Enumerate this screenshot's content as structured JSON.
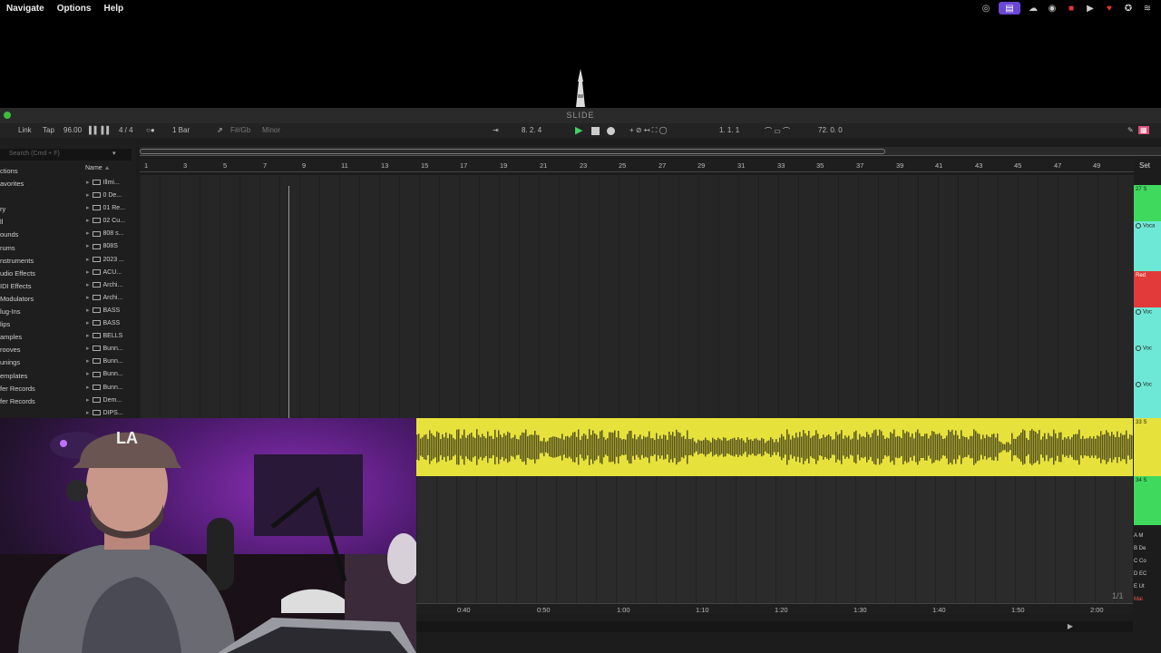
{
  "menu": [
    "Navigate",
    "Options",
    "Help"
  ],
  "status_icons": [
    "creative-cloud-icon",
    "screen-share-icon",
    "cloud-sync-icon",
    "recorder-icon",
    "play-circle-icon",
    "shield-icon",
    "compass-icon",
    "wifi-icon"
  ],
  "window": {
    "title": "SLIDE"
  },
  "control_bar": {
    "link": "Link",
    "tap": "Tap",
    "tempo": "96.00",
    "time_sig": "4 / 4",
    "quantize": "1 Bar",
    "key": "F#/Gb",
    "scale": "Minor",
    "position": "8.   2.   4",
    "loop_start": "1.   1.   1",
    "loop_length": "72.   0.   0"
  },
  "browser": {
    "search_placeholder": "Search (Cmd + F)",
    "collections_label": "ctions",
    "sidebar": [
      "avorites",
      "",
      "ry",
      "ll",
      "ounds",
      "rums",
      "nstruments",
      "udio Effects",
      "IDI Effects",
      "Modulators",
      "lug-Ins",
      "lips",
      "amples",
      "rooves",
      "unings",
      "emplates",
      "fer Records",
      "fer Records"
    ],
    "name_header": "Name",
    "files": [
      "Illmi...",
      "0 De...",
      "01 Re...",
      "02 Cu...",
      "808 s...",
      "808S",
      "2023 ...",
      "ACU...",
      "Archi...",
      "Archi...",
      "BASS",
      "BASS",
      "BELLS",
      "Bunn...",
      "Bunn...",
      "Bunn...",
      "Bunn...",
      "Dem...",
      "DIPS..."
    ]
  },
  "bar_ruler": [
    "1",
    "3",
    "5",
    "7",
    "9",
    "11",
    "13",
    "15",
    "17",
    "19",
    "21",
    "23",
    "25",
    "27",
    "29",
    "31",
    "33",
    "35",
    "37",
    "39",
    "41",
    "43",
    "45",
    "47",
    "49"
  ],
  "set_label": "Set",
  "time_ruler": [
    "0:40",
    "0:50",
    "1:00",
    "1:10",
    "1:20",
    "1:30",
    "1:40",
    "1:50",
    "2:00"
  ],
  "page_count": "1/1",
  "tracks": [
    {
      "label": "27 S",
      "color": "#3fd95e"
    },
    {
      "label": "Voca",
      "color": "#6ee8d6"
    },
    {
      "label": "Red",
      "color": "#e23a3a"
    },
    {
      "label": "Voc",
      "color": "#6ee8d6"
    },
    {
      "label": "Voc",
      "color": "#6ee8d6"
    },
    {
      "label": "Voc",
      "color": "#6ee8d6"
    },
    {
      "label": "33 S",
      "color": "#e6e23b"
    },
    {
      "label": "34 S",
      "color": "#3fd95e"
    }
  ],
  "returns": [
    "A M",
    "B De",
    "C Co",
    "D EC",
    "E Ut",
    "Mai"
  ],
  "colors": {
    "clip_yellow": "#e6e23b",
    "play_green": "#3fd463",
    "menu_active": "#6b47d6"
  }
}
